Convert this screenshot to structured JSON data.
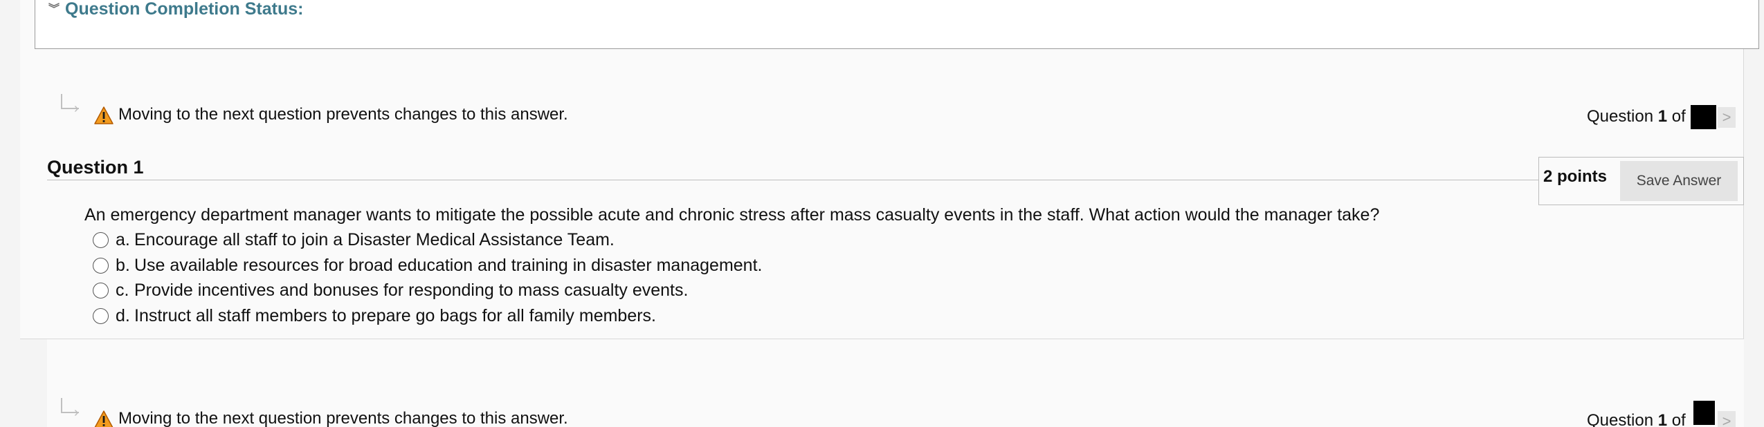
{
  "status": {
    "title": "Question Completion Status:",
    "chevron_icon": "double-chevron-down-icon"
  },
  "nav": {
    "warning_icon": "warning-triangle-icon",
    "warning_text": "Moving to the next question prevents changes to this answer.",
    "counter_prefix": "Question ",
    "counter_current": "1",
    "counter_suffix": " of",
    "next_icon": "chevron-right-icon",
    "next_label": ">"
  },
  "question": {
    "title": "Question 1",
    "points": "2 points",
    "save_label": "Save Answer",
    "text": "An emergency department manager wants to mitigate the possible acute and chronic stress after mass casualty events in the staff. What action would the manager take?",
    "options": [
      {
        "letter": "a.",
        "text": "Encourage all staff to join a Disaster Medical Assistance Team."
      },
      {
        "letter": "b.",
        "text": "Use available resources for broad education and training in disaster management."
      },
      {
        "letter": "c.",
        "text": "Provide incentives and bonuses for responding to mass casualty events."
      },
      {
        "letter": "d.",
        "text": "Instruct all staff members to prepare go bags for all family members."
      }
    ]
  },
  "colors": {
    "status_title": "#3e7a8c",
    "warning_fill": "#f39c1f",
    "save_button_bg": "#e4e4e4"
  }
}
